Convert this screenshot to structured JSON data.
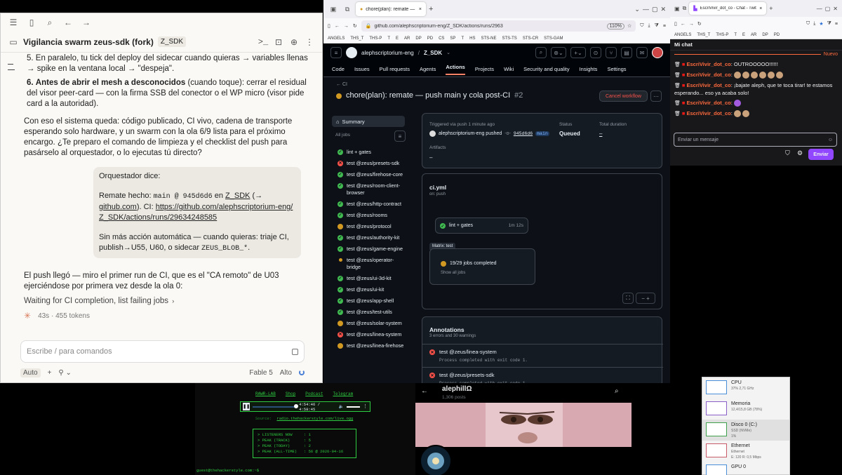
{
  "chat_app": {
    "title": "Vigilancia swarm zeus-sdk (fork)",
    "title_badge": "Z_SDK",
    "item5": "5. En paralelo, tu tick del deploy del sidecar cuando quieras → variables llenas → spike en la ventana local → \"despeja\".",
    "item6_num": "6.",
    "item6_bold": "Antes de abrir el mesh a desconocidos",
    "item6_rest": " (cuando toque): cerrar el residual del visor peer-card — con la firma SSB del conector o el WP micro (visor pide card a la autoridad).",
    "para1": "Con eso el sistema queda: código publicado, CI vivo, cadena de transporte esperando solo hardware, y un swarm con la ola 6/9 lista para el próximo encargo. ¿Te preparo el comando de limpieza y el checklist del push para pasárselo al orquestador, o lo ejecutas tú directo?",
    "bubble_head": "Orquestador dice:",
    "bubble_pre": "Remate hecho: ",
    "bubble_code": "main @ 945d6d6",
    "bubble_en": " en ",
    "bubble_link1": "Z_SDK",
    "bubble_arrow": " (→ ",
    "bubble_link2": "github.com",
    "bubble_close": "). CI: ",
    "bubble_url": "https://github.com/alephscriptorium-eng/Z_SDK/actions/runs/29634248585",
    "bubble_p2_pre": "Sin más acción automática — cuando quieras: triaje CI, publish→U55, U60, o sidecar ",
    "bubble_p2_code": "ZEUS_BLOB_*",
    "bubble_p2_end": ".",
    "para2": "El push llegó — miro el primer run de CI, que es el \"CA remoto\" de U03 ejerciéndose por primera vez desde la ola 0:",
    "status_line": "Waiting for CI completion, list failing jobs",
    "status_chevron": "›",
    "tokens": "43s · 455 tokens",
    "input_placeholder": "Escribe / para comandos",
    "footer_mode": "Auto",
    "footer_model": "Fable 5",
    "footer_effort": "Alto"
  },
  "firefox": {
    "tab_label": "chore(plan): remate — push m",
    "url": "github.com/alephscriptorium-eng/Z_SDK/actions/runs/2963",
    "zoom": "110%",
    "bookmarks": [
      "ANGELS",
      "THS_T",
      "THS-P",
      "T",
      "E",
      "AR",
      "DP",
      "PD",
      "CS",
      "SP",
      "T",
      "HS",
      "STS-NE",
      "STS-TS",
      "STS-CR",
      "STS-GAM"
    ]
  },
  "github": {
    "owner": "alephscriptorium-eng",
    "repo": "Z_SDK",
    "nav": [
      "Code",
      "Issues",
      "Pull requests",
      "Agents",
      "Actions",
      "Projects",
      "Wiki",
      "Security and quality",
      "Insights",
      "Settings"
    ],
    "active_nav": "Actions",
    "back_label": "CI",
    "run_title": "chore(plan): remate — push main y cola post-CI",
    "run_number": "#2",
    "cancel_label": "Cancel workflow",
    "summary_label": "Summary",
    "all_jobs_label": "All jobs",
    "jobs": [
      {
        "name": "lint + gates",
        "status": "ok"
      },
      {
        "name": "test @zeus/presets-sdk",
        "status": "fail"
      },
      {
        "name": "test @zeus/firehose-core",
        "status": "ok"
      },
      {
        "name": "test @zeus/room-client-browser",
        "status": "ok"
      },
      {
        "name": "test @zeus/http-contract",
        "status": "ok"
      },
      {
        "name": "test @zeus/rooms",
        "status": "ok"
      },
      {
        "name": "test @zeus/protocol",
        "status": "pend"
      },
      {
        "name": "test @zeus/authority-kit",
        "status": "ok"
      },
      {
        "name": "test @zeus/game-engine",
        "status": "ok"
      },
      {
        "name": "test @zeus/operator-bridge",
        "status": "dot"
      },
      {
        "name": "test @zeus/ui-3d-kit",
        "status": "ok"
      },
      {
        "name": "test @zeus/ui-kit",
        "status": "ok"
      },
      {
        "name": "test @zeus/app-shell",
        "status": "ok"
      },
      {
        "name": "test @zeus/test-utils",
        "status": "ok"
      },
      {
        "name": "test @zeus/solar-system",
        "status": "pend"
      },
      {
        "name": "test @zeus/linea-system",
        "status": "fail"
      },
      {
        "name": "test @zeus/linea-firehose",
        "status": "pend"
      }
    ],
    "triggered": "Triggered via push 1 minute ago",
    "pusher": "alephscriptorium-eng pushed",
    "commit": "945d6d6",
    "branch": "main",
    "status_label": "Status",
    "status_value": "Queued",
    "duration_label": "Total duration",
    "duration_value": "–",
    "artifacts_label": "Artifacts",
    "artifacts_value": "–",
    "workflow_file": "ci.yml",
    "workflow_on": "on: push",
    "node_lint": "lint + gates",
    "node_lint_time": "1m 12s",
    "matrix_label": "Matrix: test",
    "matrix_progress": "19/29 jobs completed",
    "show_all": "Show all jobs",
    "annotations_title": "Annotations",
    "annotations_sub": "3 errors and 30 warnings",
    "annotations": [
      {
        "title": "test @zeus/linea-system",
        "detail": "Process completed with exit code 1."
      },
      {
        "title": "test @zeus/presets-sdk",
        "detail": "Process completed with exit code 1."
      }
    ]
  },
  "twitch": {
    "tab_label": "EscriVivir_dot_co - Chat - Twitch",
    "chat_title": "Mi chat",
    "new_label": "Nuevo",
    "user": "EscriVivir_dot_co",
    "messages": [
      "OUTROOOOO!!!!!!",
      "",
      "¡bajate aleph, que te toca tirar! te estamos esperando... eso ya acaba solo!",
      "",
      ""
    ],
    "input_placeholder": "Enviar un mensaje",
    "send_label": "Enviar",
    "bookmarks": [
      "ANGELS",
      "THS_T",
      "THS-P",
      "T",
      "E",
      "AR",
      "DP",
      "PD"
    ]
  },
  "radio": {
    "links": [
      "RAWR-LAB",
      "Shop",
      "Podcast",
      "Telegram"
    ],
    "time": "4:54:46 / 4:58:45",
    "stream_label": "Source:",
    "stream_url": "radio.thehackerstyle.com/live.ogg",
    "stats": [
      "> LISTENERS NOW     : 1",
      "> PEAK (TRACK)      : 5",
      "> PEAK (TODAY)      : 2",
      "> PEAK (ALL-TIME)   : 56 @ 2026-04-16"
    ],
    "prompt": "guest@thehackerstyle.com:~$"
  },
  "profile": {
    "name": "alephillΩ",
    "posts": "1,306 posts"
  },
  "taskmgr": {
    "rows": [
      {
        "name": "CPU",
        "line2": "37% 2,71 GHz"
      },
      {
        "name": "Memoria",
        "line2": "12,4/15,8 GB (78%)"
      },
      {
        "name": "Disco 0 (C:)",
        "line2": "SSD (NVMe)",
        "line3": "1%"
      },
      {
        "name": "Ethernet",
        "line2": "Ethernet",
        "line3": "E: 120 R: 0,5 Mbps"
      },
      {
        "name": "GPU 0",
        "line2": ""
      }
    ]
  }
}
